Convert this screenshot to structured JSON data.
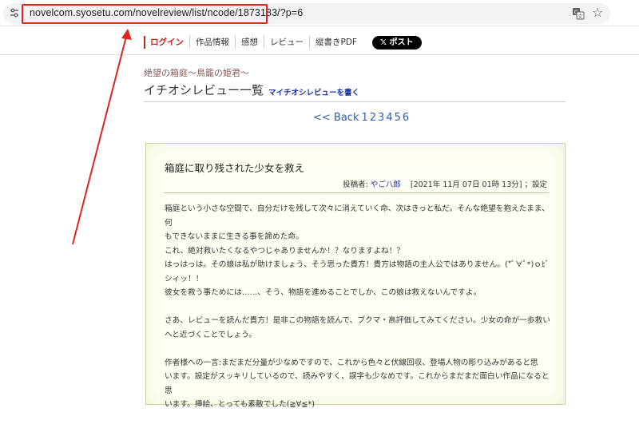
{
  "browser": {
    "url": "novelcom.syosetu.com/novelreview/list/ncode/1873183/?p=6",
    "icons": [
      "tune-icon",
      "translate-icon",
      "star-icon"
    ]
  },
  "nav": {
    "items": [
      "ログイン",
      "作品情報",
      "感想",
      "レビュー",
      "縦書きPDF"
    ],
    "post_button": "𝕏 ポスト"
  },
  "header": {
    "novel_title": "絶望の箱庭～鳥籠の姫君～",
    "page_heading": "イチオシレビュー一覧",
    "write_link": "マイチオシレビューを書く"
  },
  "pager": {
    "back": "<< Back",
    "pages": [
      "1",
      "2",
      "3",
      "4",
      "5",
      "6"
    ],
    "current": "6"
  },
  "review": {
    "title": "箱庭に取り残された少女を救え",
    "author_label": "投稿者:",
    "author": "やご八郎",
    "date": "[2021年 11月 07日 01時 13分]",
    "settings": "；設定",
    "paragraphs": [
      [
        "箱庭という小さな空間で、自分だけを残して次々に消えていく命、次はきっと私だ。そんな絶望を抱えたまま、何",
        "もできないままに生きる事を諦めた命。",
        "これ、絶対救いたくなるやつじゃありませんか！？なりますよね！？",
        "はっはっは。その娘は私が助けましょう、そう思った貴方！貴方は物語の主人公ではありません。(*ﾟ∀ﾟ*)ｏﾋﾞ",
        "シィッ！！",
        "彼女を救う事ためには……、そう、物語を進めることでしか、この娘は救えないんですよ。"
      ],
      [
        "さあ、レビューを読んだ貴方！是非この物語を読んで、ブクマ・高評価してみてください。少女の命が一歩救い",
        "へと近づくことでしょう。"
      ],
      [
        "作者様への一言:まだまだ分量が少なめですので、これから色々と伏線回収、登場人物の彫り込みがあると思",
        "います。設定がスッキリしているので、読みやすく、誤字も少なめです。これからまだまだ面白い作品になると思",
        "います。挿絵、とっても素敵でした(≧∀≦*)"
      ]
    ]
  },
  "colors": {
    "annotation_red": "#e0241f",
    "link_blue": "#2c5fa8",
    "login_red": "#cc2020",
    "review_bg": "#fffff4"
  }
}
